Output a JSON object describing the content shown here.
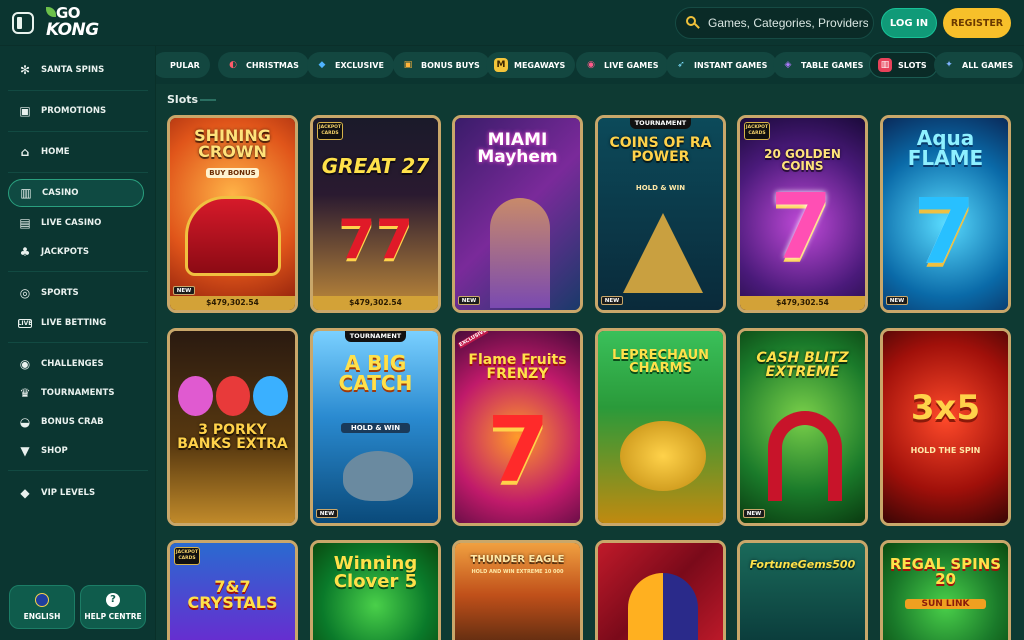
{
  "header": {
    "logo_top": "GO",
    "logo_bottom": "KONG",
    "search_placeholder": "Games, Categories, Providers",
    "login_label": "LOG IN",
    "register_label": "REGISTER"
  },
  "sidebar": {
    "items": [
      {
        "label": "SANTA SPINS",
        "icon": "snowflake-icon"
      },
      {
        "label": "PROMOTIONS",
        "icon": "gift-icon"
      },
      {
        "label": "HOME",
        "icon": "home-icon"
      },
      {
        "label": "CASINO",
        "icon": "slot-icon"
      },
      {
        "label": "LIVE CASINO",
        "icon": "cards-icon"
      },
      {
        "label": "JACKPOTS",
        "icon": "clover-icon"
      },
      {
        "label": "SPORTS",
        "icon": "ball-icon"
      },
      {
        "label": "LIVE BETTING",
        "icon": "live-icon"
      },
      {
        "label": "CHALLENGES",
        "icon": "target-icon"
      },
      {
        "label": "TOURNAMENTS",
        "icon": "trophy-icon"
      },
      {
        "label": "BONUS CRAB",
        "icon": "crab-icon"
      },
      {
        "label": "SHOP",
        "icon": "basket-icon"
      },
      {
        "label": "VIP LEVELS",
        "icon": "diamond-icon"
      }
    ],
    "language_label": "ENGLISH",
    "help_label": "HELP CENTRE"
  },
  "categories": [
    {
      "label": "PULAR",
      "icon": ""
    },
    {
      "label": "CHRISTMAS",
      "icon": "candy-icon"
    },
    {
      "label": "EXCLUSIVE",
      "icon": "gem-icon"
    },
    {
      "label": "BONUS BUYS",
      "icon": "gift-box-icon"
    },
    {
      "label": "MEGAWAYS",
      "icon": "megaways-icon"
    },
    {
      "label": "LIVE GAMES",
      "icon": "live-games-icon"
    },
    {
      "label": "INSTANT GAMES",
      "icon": "rocket-icon"
    },
    {
      "label": "TABLE GAMES",
      "icon": "dice-icon"
    },
    {
      "label": "SLOTS",
      "icon": "slot-machine-icon"
    },
    {
      "label": "ALL GAMES",
      "icon": "all-games-icon"
    }
  ],
  "section": {
    "title": "Slots"
  },
  "games": [
    {
      "title": "SHINING CROWN",
      "sub": "BUY BONUS",
      "new": true,
      "jackpot": "$479,302.54"
    },
    {
      "title": "GREAT 27",
      "sub": "JACKPOT CARDS",
      "new": false,
      "jackpot": "$479,302.54"
    },
    {
      "title": "MIAMI Mayhem",
      "sub": "",
      "new": true,
      "jackpot": ""
    },
    {
      "title": "COINS OF RA POWER",
      "sub": "HOLD & WIN",
      "tournament": "TOURNAMENT",
      "new": true,
      "jackpot": ""
    },
    {
      "title": "20 GOLDEN COINS",
      "sub": "JACKPOT CARDS",
      "new": false,
      "jackpot": "$479,302.54"
    },
    {
      "title": "Aqua FLAME",
      "sub": "",
      "new": true,
      "jackpot": ""
    },
    {
      "title": "3 PORKY BANKS EXTRA",
      "sub": "",
      "new": false,
      "jackpot": ""
    },
    {
      "title": "A BIG CATCH",
      "sub": "HOLD & WIN",
      "tournament": "TOURNAMENT",
      "new": true,
      "jackpot": ""
    },
    {
      "title": "Flame Fruits FRENZY",
      "sub": "EXCLUSIVE",
      "new": false,
      "jackpot": ""
    },
    {
      "title": "LEPRECHAUN CHARMS",
      "sub": "",
      "new": false,
      "jackpot": ""
    },
    {
      "title": "CASH BLITZ EXTREME",
      "sub": "",
      "new": true,
      "jackpot": ""
    },
    {
      "title": "3x5",
      "sub": "HOLD THE SPIN",
      "new": false,
      "jackpot": ""
    },
    {
      "title": "7&7 CRYSTALS",
      "sub": "JACKPOT CARDS",
      "new": false,
      "jackpot": ""
    },
    {
      "title": "Winning Clover 5",
      "sub": "",
      "new": false,
      "jackpot": ""
    },
    {
      "title": "THUNDER EAGLE",
      "sub": "HOLD AND WIN EXTREME 10 000",
      "new": false,
      "jackpot": ""
    },
    {
      "title": "",
      "sub": "",
      "new": false,
      "jackpot": ""
    },
    {
      "title": "FortuneGems500",
      "sub": "",
      "new": false,
      "jackpot": ""
    },
    {
      "title": "REGAL SPINS 20",
      "sub": "SUN LINK",
      "new": false,
      "jackpot": ""
    }
  ],
  "badge_new": "NEW"
}
